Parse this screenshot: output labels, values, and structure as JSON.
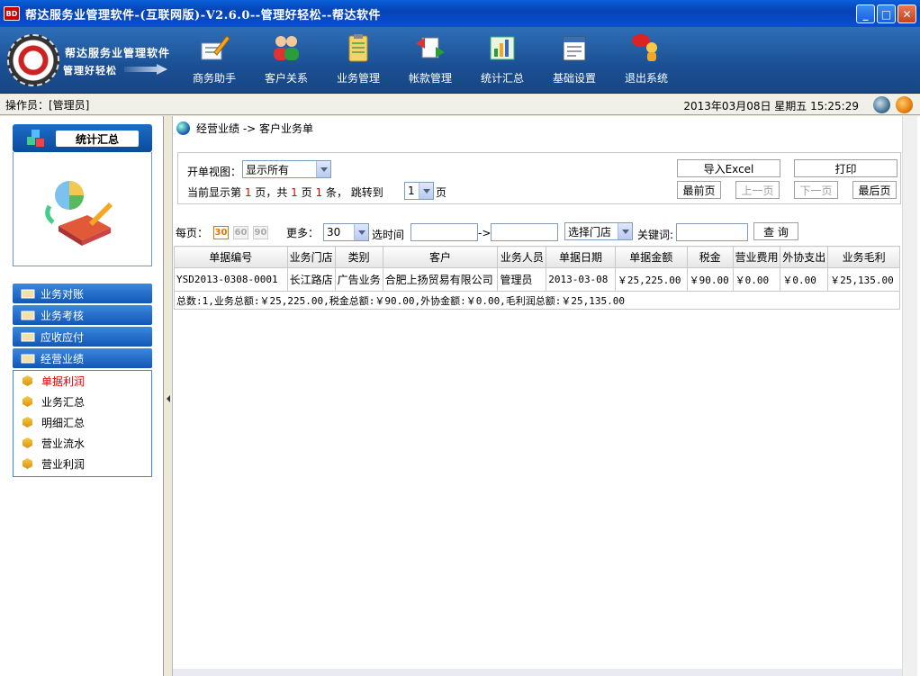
{
  "window": {
    "badge": "BD",
    "title": "帮达服务业管理软件-(互联网版)-V2.6.0--管理好轻松--帮达软件",
    "min": "_",
    "max": "□",
    "close": "✕"
  },
  "brand": {
    "line1": "帮达服务业管理软件",
    "line2": "管理好轻松"
  },
  "toolbar": [
    {
      "label": "商务助手",
      "icon": "pencil-clipboard-icon"
    },
    {
      "label": "客户关系",
      "icon": "users-icon"
    },
    {
      "label": "业务管理",
      "icon": "clipboard-icon"
    },
    {
      "label": "帐款管理",
      "icon": "transfer-icon"
    },
    {
      "label": "统计汇总",
      "icon": "chart-icon"
    },
    {
      "label": "基础设置",
      "icon": "settings-document-icon"
    },
    {
      "label": "退出系统",
      "icon": "exit-icon"
    }
  ],
  "status": {
    "operator": "操作员：[管理员]",
    "datetime": "2013年03月08日  星期五  15:25:29"
  },
  "sidebar": {
    "header": "统计汇总",
    "groups": [
      "业务对账",
      "业务考核",
      "应收应付",
      "经营业绩"
    ],
    "subitems": [
      "单据利润",
      "业务汇总",
      "明细汇总",
      "营业流水",
      "营业利润"
    ],
    "active": "单据利润"
  },
  "breadcrumb": "经营业绩  ->  客户业务单",
  "filter": {
    "view_label": "开单视图：",
    "view_value": "显示所有",
    "page_prefix": "当前显示第",
    "page_current": "1",
    "page_mid1": "页，共",
    "page_total": "1",
    "page_mid2": "页",
    "record_count": "1",
    "page_suffix": "条，  跳转到",
    "jump_value": "1",
    "jump_suffix": "页",
    "export_btn": "导入Excel",
    "print_btn": "打印",
    "first_btn": "最前页",
    "prev_btn": "上一页",
    "next_btn": "下一页",
    "last_btn": "最后页"
  },
  "query": {
    "perpage_label": "每页：",
    "perpage_opts": [
      "30",
      "60",
      "90"
    ],
    "more_label": "更多：",
    "more_value": "30",
    "time_label": "选时间",
    "arrow": "->",
    "store_value": "选择门店",
    "keyword_label": "关键词:",
    "search_btn": "查 询"
  },
  "table": {
    "headers": [
      "单据编号",
      "业务门店",
      "类别",
      "客户",
      "业务人员",
      "单据日期",
      "单据金额",
      "税金",
      "营业费用",
      "外协支出",
      "业务毛利"
    ],
    "rows": [
      [
        "YSD2013-0308-0001",
        "长江路店",
        "广告业务",
        "合肥上扬贸易有限公司",
        "管理员",
        "2013-03-08",
        "￥25,225.00",
        "￥90.00",
        "￥0.00",
        "￥0.00",
        "￥25,135.00"
      ]
    ],
    "summary": "总数:1,业务总额:￥25,225.00,税金总额:￥90.00,外协金额:￥0.00,毛利润总额:￥25,135.00"
  }
}
